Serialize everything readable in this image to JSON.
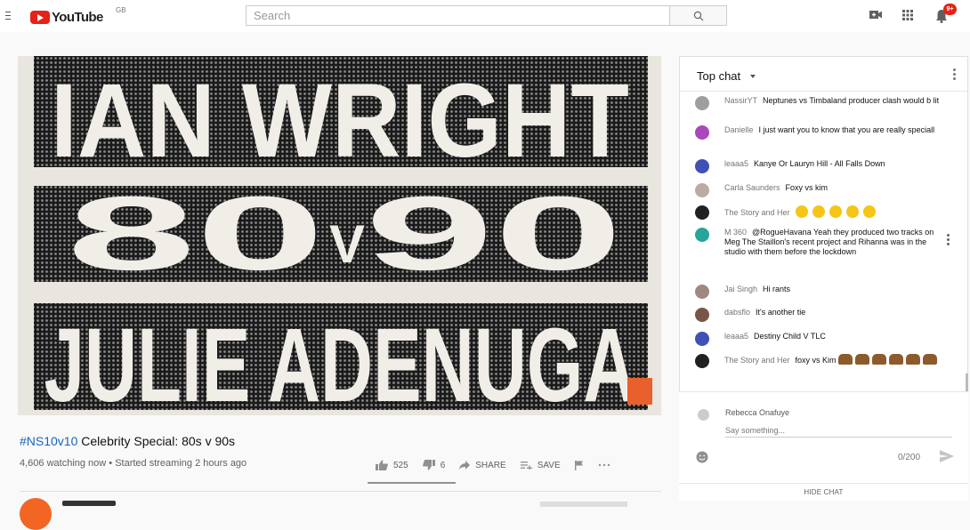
{
  "header": {
    "logo_text": "YouTube",
    "region": "GB",
    "search_placeholder": "Search",
    "notification_count": "9+",
    "icons": [
      "menu-icon",
      "search-icon",
      "video-camera-icon",
      "apps-grid-icon",
      "notification-bell-icon"
    ]
  },
  "video": {
    "poster_lines": [
      "IAN WRIGHT",
      "80",
      "V",
      "90",
      "JULIE ADENUGA"
    ],
    "title_hashtag": "#NS10v10",
    "title_rest": " Celebrity Special: 80s v 90s",
    "meta": "4,606 watching now • Started streaming 2 hours ago",
    "likes": "525",
    "dislikes": "6",
    "share_label": "SHARE",
    "save_label": "SAVE",
    "like_ratio": 0.99
  },
  "chat": {
    "title": "Top chat",
    "messages": [
      {
        "author": "NassirYT",
        "text": "Neptunes vs Timbaland producer clash would b lit",
        "avatar_color": "#9e9e9e"
      },
      {
        "author": "Danielle",
        "text": "I just want you to know that you are really speciall",
        "avatar_color": "#ab47bc"
      },
      {
        "author": "leaaa5",
        "text": "Kanye Or Lauryn Hill - All Falls Down",
        "avatar_color": "#3f51b5"
      },
      {
        "author": "Carla Saunders",
        "text": "Foxy vs kim",
        "avatar_color": "#bcaaa4"
      },
      {
        "author": "The Story and Her",
        "text": "",
        "emojis": 5,
        "avatar_color": "#212121"
      },
      {
        "author": "M 360",
        "text": "@RogueHavana Yeah they produced two tracks on Meg The Staillon's recent project and Rihanna was in the studio with them before the lockdown",
        "avatar_color": "#26a69a"
      },
      {
        "author": "Jai Singh",
        "text": "Hi rants",
        "avatar_color": "#a1887f"
      },
      {
        "author": "dabsflo",
        "text": "It's another tie",
        "avatar_color": "#795548"
      },
      {
        "author": "leaaa5",
        "text": "Destiny Child V TLC",
        "avatar_color": "#3f51b5"
      },
      {
        "author": "The Story and Her",
        "text": "foxy vs Kim",
        "hands": 6,
        "avatar_color": "#212121"
      }
    ],
    "current_user": "Rebecca Onafuye",
    "input_placeholder": "Say something...",
    "char_counter": "0/200",
    "hide_chat_label": "HIDE CHAT"
  }
}
